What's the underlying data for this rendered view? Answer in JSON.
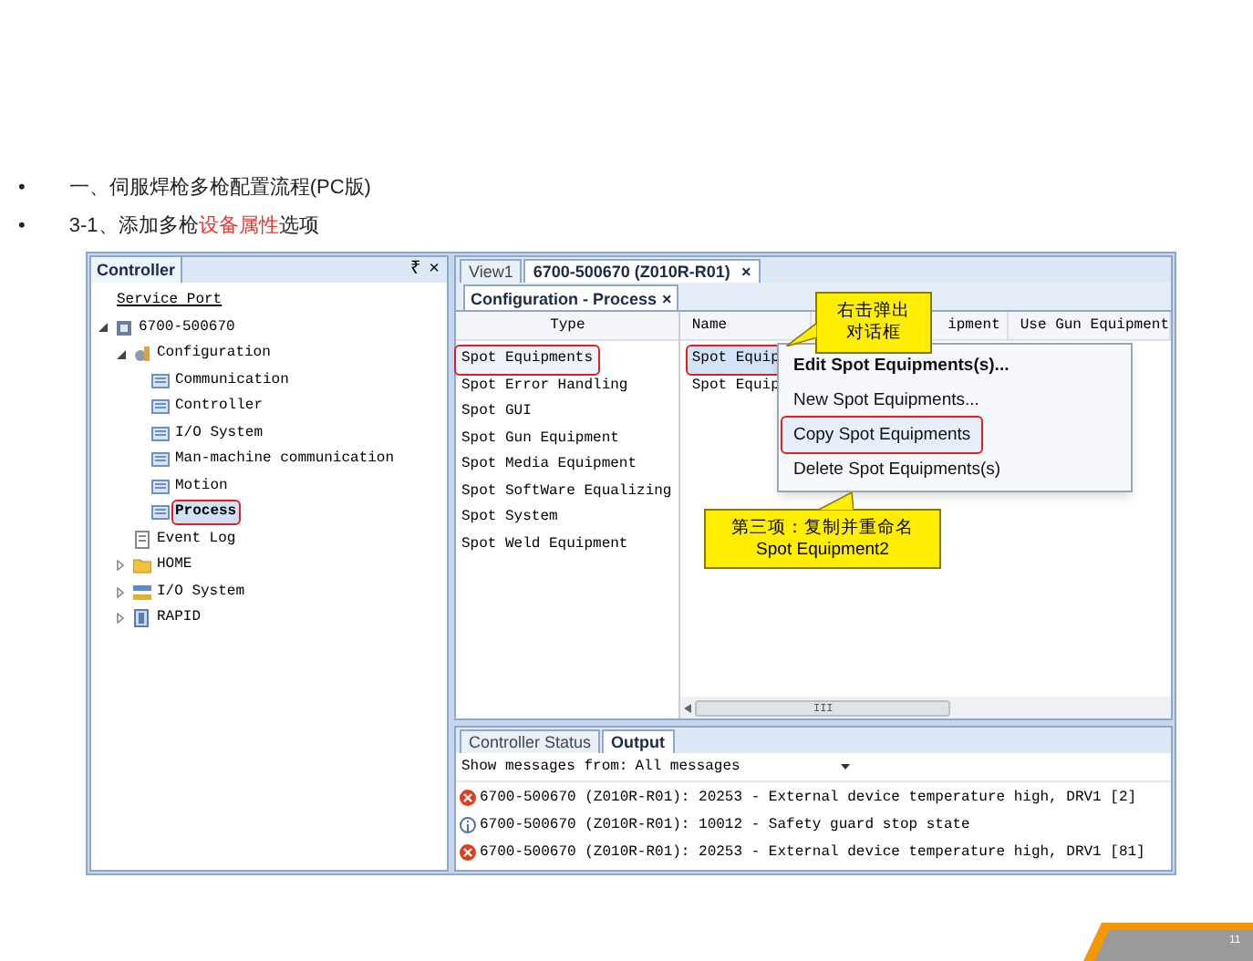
{
  "bullets": [
    {
      "marker": "•",
      "parts": [
        {
          "text": "一、伺服焊枪多枪配置流程(PC版)",
          "highlight": false
        }
      ]
    },
    {
      "marker": "•",
      "parts": [
        {
          "text": "3-1、添加多枪",
          "highlight": false
        },
        {
          "text": "设备属性",
          "highlight": true
        },
        {
          "text": "选项",
          "highlight": false
        }
      ]
    }
  ],
  "controller_panel": {
    "title": "Controller",
    "pin": "₹",
    "close": "×",
    "tree": [
      {
        "label": "Service Port",
        "kind": "link",
        "selected": false
      },
      {
        "label": "6700-500670",
        "kind": "controller",
        "expanded": true,
        "selected": false,
        "children": [
          {
            "label": "Configuration",
            "kind": "config",
            "expanded": true,
            "selected": false,
            "children": [
              {
                "label": "Communication",
                "kind": "topic",
                "selected": false
              },
              {
                "label": "Controller",
                "kind": "topic",
                "selected": false
              },
              {
                "label": "I/O System",
                "kind": "topic",
                "selected": false
              },
              {
                "label": "Man-machine communication",
                "kind": "topic",
                "selected": false
              },
              {
                "label": "Motion",
                "kind": "topic",
                "selected": false
              },
              {
                "label": "Process",
                "kind": "topic",
                "selected": true
              }
            ]
          },
          {
            "label": "Event Log",
            "kind": "log",
            "selected": false
          },
          {
            "label": "HOME",
            "kind": "folder",
            "expanded": false,
            "selected": false
          },
          {
            "label": "I/O System",
            "kind": "io",
            "expanded": false,
            "selected": false
          },
          {
            "label": "RAPID",
            "kind": "rapid",
            "expanded": false,
            "selected": false
          }
        ]
      }
    ]
  },
  "document_tabs": [
    {
      "label": "View1",
      "selected": false
    },
    {
      "label": "6700-500670 (Z010R-R01)",
      "selected": true,
      "close": "×"
    }
  ],
  "config_tab": {
    "label": "Configuration - Process",
    "close": "×"
  },
  "type_list": {
    "header": "Type",
    "items": [
      {
        "label": "Spot Equipments",
        "selected": true
      },
      {
        "label": "Spot Error Handling",
        "selected": false
      },
      {
        "label": "Spot GUI",
        "selected": false
      },
      {
        "label": "Spot Gun Equipment",
        "selected": false
      },
      {
        "label": "Spot Media Equipment",
        "selected": false
      },
      {
        "label": "Spot SoftWare Equalizing",
        "selected": false
      },
      {
        "label": "Spot System",
        "selected": false
      },
      {
        "label": "Spot Weld Equipment",
        "selected": false
      }
    ]
  },
  "instance_table": {
    "columns": [
      "Name",
      "ipment",
      "Use Gun Equipment"
    ],
    "rows": [
      {
        "name": "Spot Equip",
        "selected": true
      },
      {
        "name": "Spot Equip",
        "selected": false
      }
    ],
    "scroll_grip": "III"
  },
  "context_menu": [
    {
      "label": "Edit Spot Equipments(s)...",
      "bold": true,
      "selected": false
    },
    {
      "label": "New Spot Equipments...",
      "bold": false,
      "selected": false
    },
    {
      "label": "Copy Spot Equipments",
      "bold": false,
      "selected": true
    },
    {
      "label": "Delete Spot Equipments(s)",
      "bold": false,
      "selected": false
    }
  ],
  "callouts": [
    {
      "lines": [
        "右击弹出",
        "对话框"
      ]
    },
    {
      "lines": [
        "第三项：复制并重命名",
        "Spot Equipment2"
      ]
    }
  ],
  "output_panel": {
    "tabs": [
      {
        "label": "Controller Status",
        "selected": false
      },
      {
        "label": "Output",
        "selected": true
      }
    ],
    "filter_label": "Show messages from:",
    "filter_value": "All messages",
    "messages": [
      {
        "kind": "error",
        "text": "6700-500670 (Z010R-R01): 20253 - External device temperature high, DRV1 [2]"
      },
      {
        "kind": "info",
        "text": "6700-500670 (Z010R-R01): 10012 - Safety guard stop state"
      },
      {
        "kind": "error",
        "text": "6700-500670 (Z010R-R01): 20253 - External device temperature high, DRV1 [81]"
      }
    ]
  },
  "page_number": "11"
}
